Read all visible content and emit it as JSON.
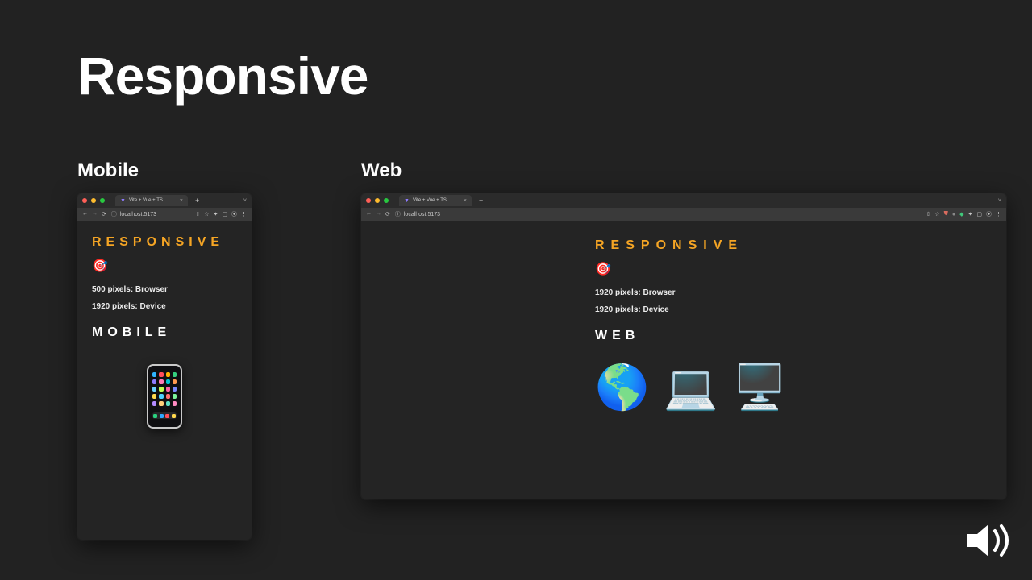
{
  "slide": {
    "title": "Responsive",
    "mobile_label": "Mobile",
    "web_label": "Web"
  },
  "browser_common": {
    "tab_title": "Vite + Vue + TS",
    "vite_glyph": "▼",
    "close_x": "×",
    "plus": "+",
    "chev_down": "˅",
    "back": "←",
    "forward": "→",
    "reload": "⟳",
    "info": "ⓘ",
    "url": "localhost:5173",
    "share": "⇧",
    "star": "☆",
    "shield": "⛊",
    "puzzle": "✦",
    "window": "▢",
    "profile": "⦿",
    "menu": "⋮"
  },
  "content": {
    "heading": "RESPONSIVE",
    "target_emoji": "🎯"
  },
  "mobile": {
    "line1": "500 pixels: Browser",
    "line2": "1920 pixels: Device",
    "mode": "MOBILE"
  },
  "web": {
    "line1": "1920 pixels: Browser",
    "line2": "1920 pixels: Device",
    "mode": "WEB",
    "icons": {
      "globe": "🌎",
      "laptop": "💻",
      "desktop": "🖥️"
    }
  },
  "phone_app_colors": [
    "#2fb3ff",
    "#ff4d5a",
    "#ffb300",
    "#35d07f",
    "#8e7bff",
    "#ff7ab6",
    "#00c2d1",
    "#ff9950",
    "#6ad1ff",
    "#c0ff4d",
    "#ff5fa2",
    "#7a88ff",
    "#ffd84d",
    "#4dd2ff",
    "#ff6e6e",
    "#7cf59b",
    "#b38bff",
    "#ffcf7a",
    "#5ee0c5",
    "#ff8ac2"
  ],
  "phone_dock_colors": [
    "#29d07f",
    "#2fa8ff",
    "#ff4d5a",
    "#ffd84d"
  ]
}
